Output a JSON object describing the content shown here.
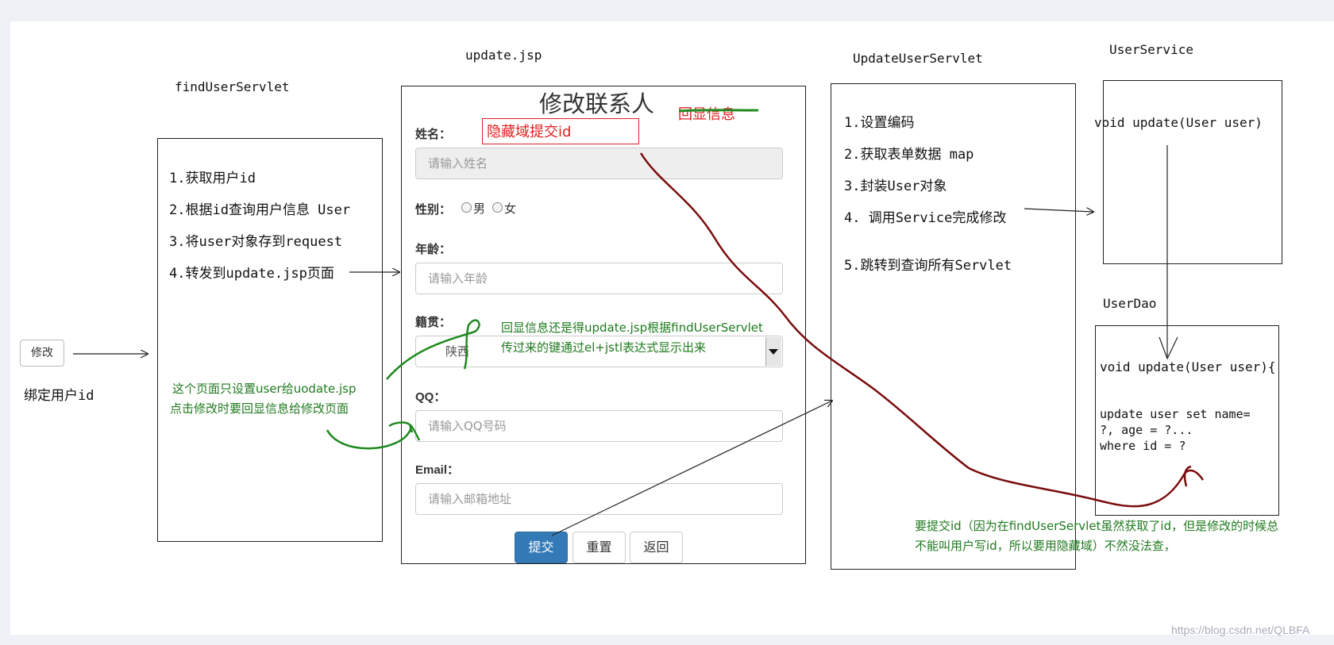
{
  "left": {
    "modify_button": "修改",
    "bind_label": "绑定用户id"
  },
  "find_servlet": {
    "title": "findUserServlet",
    "steps": [
      "1.获取用户id",
      "2.根据id查询用户信息 User",
      "3.将user对象存到request",
      "4.转发到update.jsp页面"
    ],
    "note_line1": "这个页面只设置user给uodate.jsp",
    "note_line2": "点击修改时要回显信息给修改页面"
  },
  "update_jsp": {
    "title": "update.jsp",
    "heading": "修改联系人",
    "echo_label": "回显信息",
    "hidden_field_note": "隐藏域提交id",
    "name_label": "姓名：",
    "name_placeholder": "请输入姓名",
    "gender_label": "性别：",
    "gender_male": "男",
    "gender_female": "女",
    "age_label": "年龄：",
    "age_placeholder": "请输入年龄",
    "native_label": "籍贯：",
    "native_value": "陕西",
    "qq_label": "QQ：",
    "qq_placeholder": "请输入QQ号码",
    "email_label": "Email：",
    "email_placeholder": "请输入邮箱地址",
    "submit": "提交",
    "reset": "重置",
    "back": "返回",
    "echo_note_line1": "回显信息还是得update.jsp根据findUserServlet",
    "echo_note_line2": "传过来的键通过el+jstl表达式显示出来"
  },
  "update_servlet": {
    "title": "UpdateUserServlet",
    "steps": [
      "1.设置编码",
      "2.获取表单数据 map",
      "3.封装User对象",
      "4.  调用Service完成修改",
      "5.跳转到查询所有Servlet"
    ]
  },
  "user_service": {
    "title": "UserService",
    "method": "void update(User user)"
  },
  "user_dao": {
    "title": "UserDao",
    "method": "void update(User user){",
    "sql_line1": " update user set name=",
    "sql_line2": "?, age = ?...",
    "sql_line3": "where id = ?"
  },
  "bottom_note": {
    "line1": "要提交id（因为在findUserServlet虽然获取了id，但是修改的时候总",
    "line2": "不能叫用户写id，所以要用隐藏域）不然没法查，"
  },
  "watermark": "https://blog.csdn.net/QLBFA",
  "colors": {
    "annotation_green": "#1f7a1f",
    "annotation_red": "#e02020",
    "path_dark_red": "#7a0c0c",
    "submit_blue": "#337ab7"
  }
}
